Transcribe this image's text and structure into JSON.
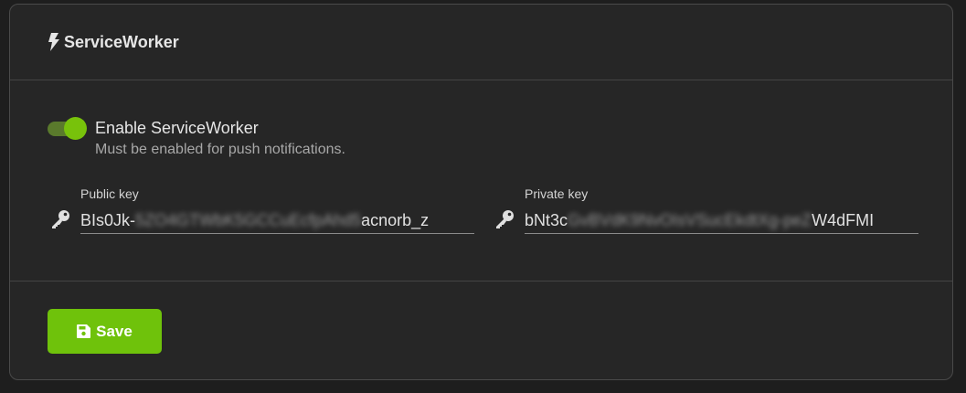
{
  "card": {
    "title": "ServiceWorker"
  },
  "toggle": {
    "label": "Enable ServiceWorker",
    "help": "Must be enabled for push notifications.",
    "enabled": true,
    "color_on": "#78c20b"
  },
  "public_key": {
    "label": "Public key",
    "value_start": "BIs0Jk-",
    "value_hidden": "5ZO4GTWbK5GCCuEcfpAhd5",
    "value_end": "acnorb_z"
  },
  "private_key": {
    "label": "Private key",
    "value_start": "bNt3c",
    "value_hidden": "GvBVdK9NvOIsVSucEkdtXg-peZ",
    "value_end": "W4dFMI"
  },
  "footer": {
    "save_label": "Save",
    "accent": "#6fc20b"
  },
  "icons": {
    "header": "bolt-icon",
    "fields": "key-icon",
    "save": "floppy-disk-icon"
  }
}
